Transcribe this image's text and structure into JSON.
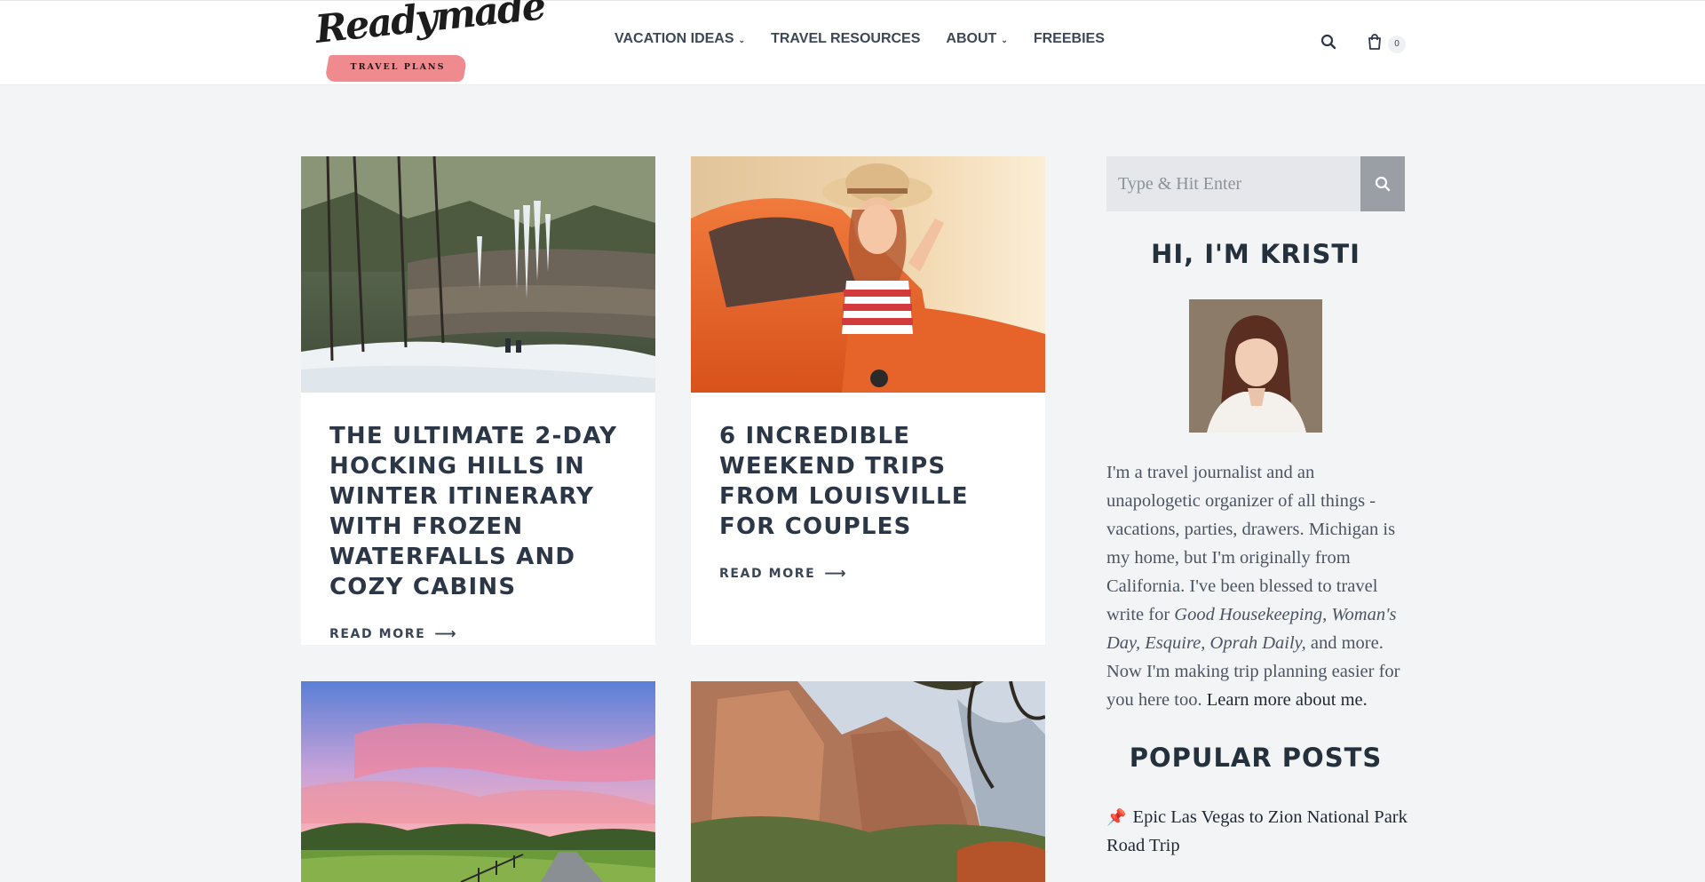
{
  "header": {
    "logo": {
      "script_text": "Readymade",
      "sub_text": "TRAVEL PLANS"
    },
    "nav": [
      {
        "label": "VACATION IDEAS",
        "has_dropdown": true
      },
      {
        "label": "TRAVEL RESOURCES",
        "has_dropdown": false
      },
      {
        "label": "ABOUT",
        "has_dropdown": true
      },
      {
        "label": "FREEBIES",
        "has_dropdown": false
      }
    ],
    "search_icon": "search-icon",
    "cart": {
      "icon": "cart-icon",
      "count": "0"
    }
  },
  "posts": [
    {
      "title": "THE ULTIMATE 2-DAY HOCKING HILLS IN WINTER ITINERARY WITH FROZEN WATERFALLS AND COZY CABINS",
      "read_more": "READ MORE",
      "image": "snowy gorge with icicles"
    },
    {
      "title": "6 INCREDIBLE WEEKEND TRIPS FROM LOUISVILLE FOR COUPLES",
      "read_more": "READ MORE",
      "image": "woman in hat leaning out of orange car"
    },
    {
      "title": "",
      "read_more": "",
      "image": "country road at sunset"
    },
    {
      "title": "",
      "read_more": "",
      "image": "canyon cliffs with trees"
    }
  ],
  "sidebar": {
    "search": {
      "placeholder": "Type & Hit Enter",
      "value": ""
    },
    "about_heading": "HI, I'M KRISTI",
    "bio_part1": "I'm a travel journalist and an unapologetic organizer of all things - vacations, parties, drawers. Michigan is my home, but I'm originally from California. I've been blessed to travel write for ",
    "bio_publications": "Good Housekeeping, Woman's Day, Esquire, Oprah Daily,",
    "bio_part2": " and more. Now I'm making trip planning easier for you here too. ",
    "bio_link": "Learn more about me.",
    "popular_heading": "POPULAR POSTS",
    "popular_posts": [
      "Epic Las Vegas to Zion National Park Road Trip"
    ]
  },
  "colors": {
    "background": "#f3f4f6",
    "card": "#ffffff",
    "heading": "#2b3746",
    "logo_brush": "#ef8a8e"
  }
}
